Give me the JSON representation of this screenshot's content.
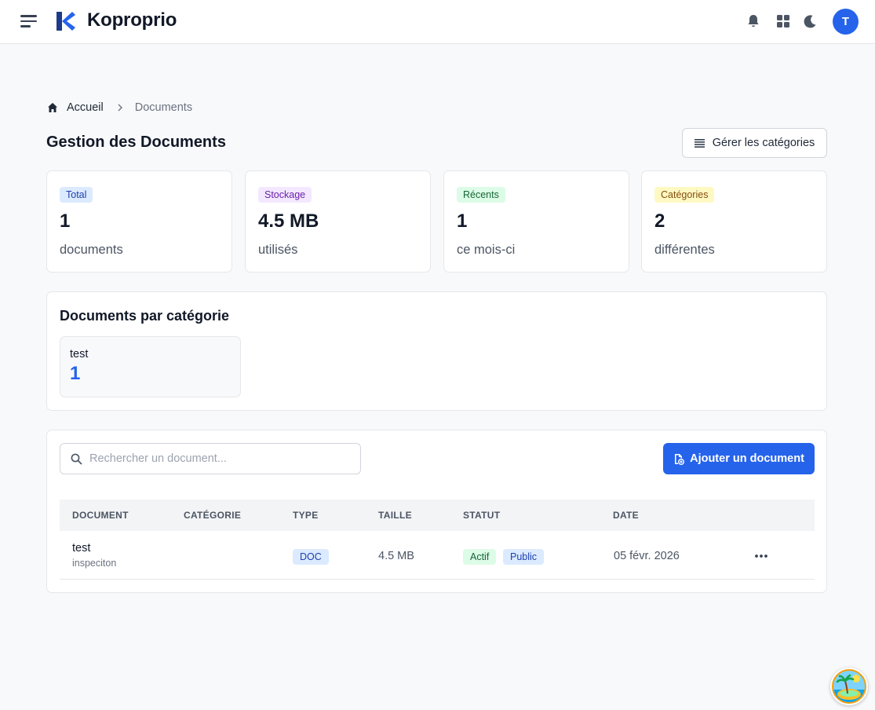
{
  "header": {
    "brand": "Koproprio",
    "avatar_initial": "T",
    "icons": [
      "menu-icon",
      "bell-icon",
      "apps-grid-icon",
      "moon-icon"
    ],
    "brand_color": "#1e40af"
  },
  "breadcrumb": {
    "home": "Accueil",
    "current": "Documents"
  },
  "page": {
    "title": "Gestion des Documents",
    "manage_categories_label": "Gérer les catégories"
  },
  "stats": [
    {
      "badge": "Total",
      "value": "1",
      "caption": "documents",
      "badge_bg": "#dbeafe",
      "badge_fg": "#1e40af"
    },
    {
      "badge": "Stockage",
      "value": "4.5 MB",
      "caption": "utilisés",
      "badge_bg": "#f3e8ff",
      "badge_fg": "#6b21a8"
    },
    {
      "badge": "Récents",
      "value": "1",
      "caption": "ce mois-ci",
      "badge_bg": "#dcfce7",
      "badge_fg": "#166534"
    },
    {
      "badge": "Catégories",
      "value": "2",
      "caption": "différentes",
      "badge_bg": "#fef9c3",
      "badge_fg": "#854d0e"
    }
  ],
  "categories_panel": {
    "title": "Documents par catégorie",
    "items": [
      {
        "name": "test",
        "count": "1"
      }
    ]
  },
  "documents_panel": {
    "search_placeholder": "Rechercher un document...",
    "add_label": "Ajouter un document",
    "columns": [
      "DOCUMENT",
      "CATÉGORIE",
      "TYPE",
      "TAILLE",
      "STATUT",
      "DATE"
    ],
    "rows": [
      {
        "name": "test",
        "description": "inspeciton",
        "category": "",
        "type": "DOC",
        "size": "4.5 MB",
        "status": "Actif",
        "visibility": "Public",
        "date": "05 févr. 2026"
      }
    ]
  },
  "accent_color": "#2563eb"
}
